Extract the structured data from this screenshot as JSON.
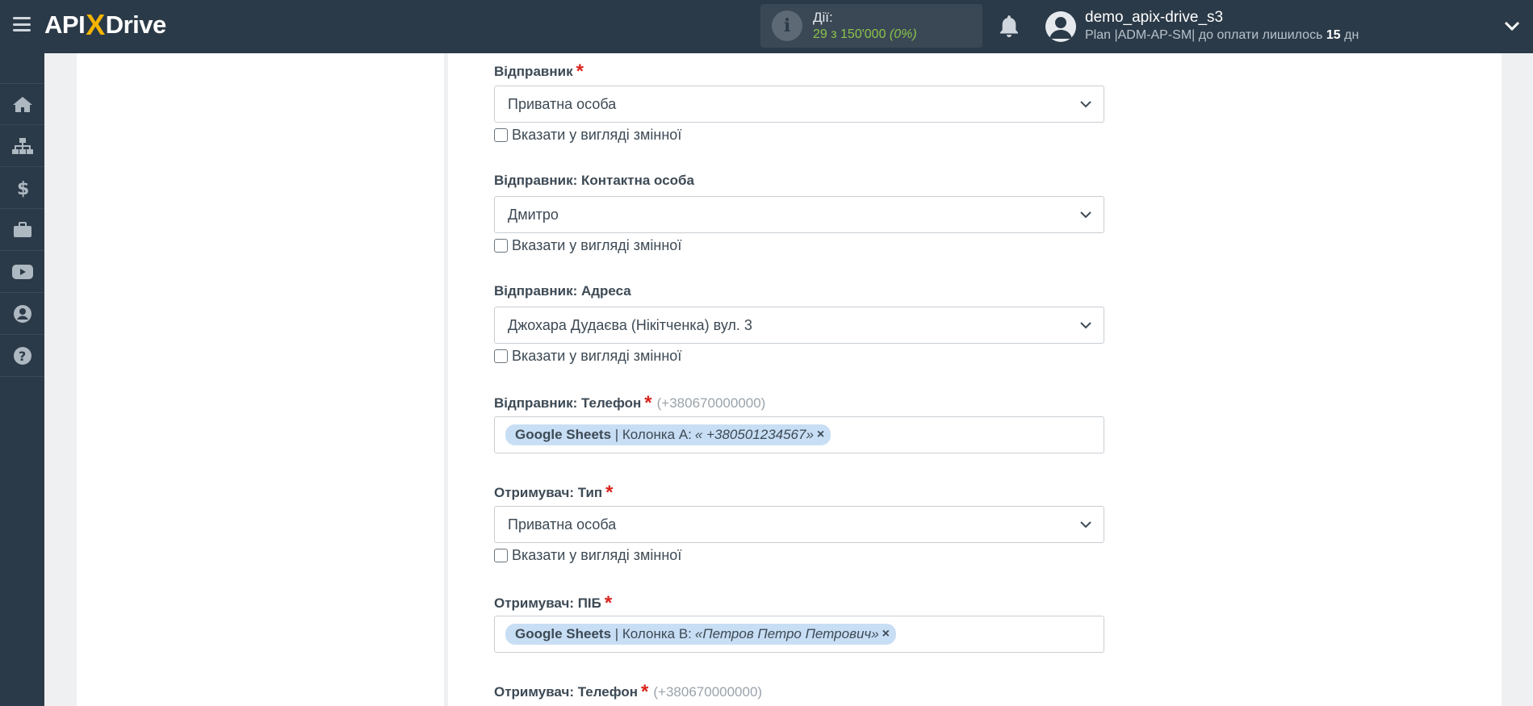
{
  "header": {
    "logo_left": "API",
    "logo_x": "X",
    "logo_right": "Drive",
    "actions_title": "Дії:",
    "actions_count": "29 з 150'000",
    "actions_pct": "(0%)",
    "user_name": "demo_apix-drive_s3",
    "plan_text": "Plan |ADM-AP-SM| до оплати лишилось",
    "plan_days": "15",
    "plan_unit": "дн"
  },
  "sidebar": {
    "items": [
      "home-icon",
      "sitemap-icon",
      "dollar-icon",
      "briefcase-icon",
      "youtube-icon",
      "user-icon",
      "help-icon"
    ]
  },
  "form": {
    "checkbox_label": "Вказати у вигляді змінної",
    "sender": {
      "label": "Відправник",
      "value": "Приватна особа"
    },
    "sender_contact": {
      "label": "Відправник: Контактна особа",
      "value": "Дмитро"
    },
    "sender_address": {
      "label": "Відправник: Адреса",
      "value": "Джохара Дудаєва (Нікітченка) вул. 3"
    },
    "sender_phone": {
      "label": "Відправник: Телефон",
      "hint": "(+380670000000)",
      "tag_source": "Google Sheets",
      "tag_column": "| Колонка A:",
      "tag_value": "« +380501234567»"
    },
    "recipient_type": {
      "label": "Отримувач: Тип",
      "value": "Приватна особа"
    },
    "recipient_name": {
      "label": "Отримувач: ПІБ",
      "tag_source": "Google Sheets",
      "tag_column": "| Колонка B:",
      "tag_value": "«Петров Петро Петрович»"
    },
    "recipient_phone": {
      "label": "Отримувач: Телефон",
      "hint": "(+380670000000)"
    },
    "required_mark": "*",
    "remove_mark": "×"
  },
  "colors": {
    "topbar": "#2b3a48",
    "accent_logo": "#f5b400",
    "actions_green": "#8bc34a",
    "required_red": "#d9241c",
    "tag_bg": "#c8def4"
  }
}
